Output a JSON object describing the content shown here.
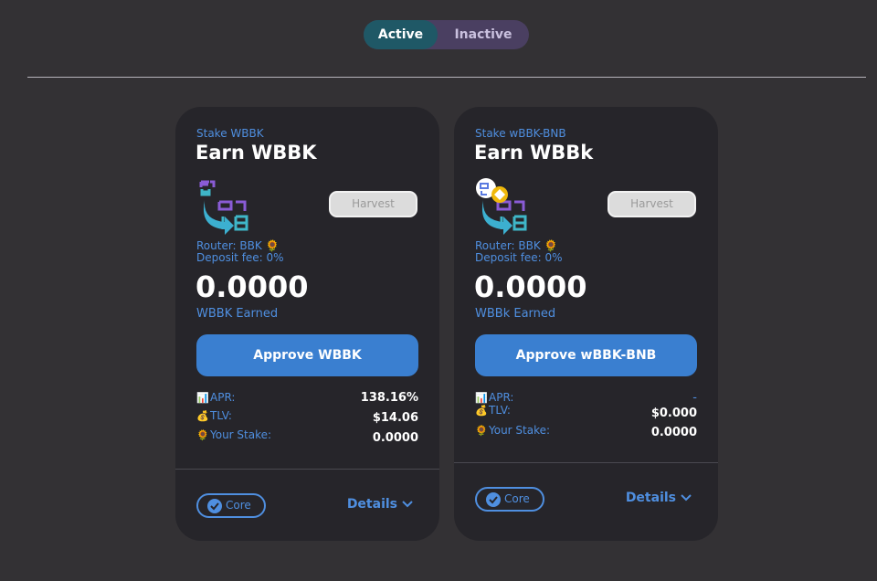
{
  "toggle": {
    "active_label": "Active",
    "inactive_label": "Inactive"
  },
  "cards": [
    {
      "stake_label": "Stake WBBK",
      "earn_title": "Earn WBBK",
      "harvest_label": "Harvest",
      "router": "Router: BBK 🌻",
      "deposit_fee": "Deposit fee: 0%",
      "amount": "0.0000",
      "earned_label": "WBBK Earned",
      "approve_label": "Approve WBBK",
      "apr_label": "APR:",
      "apr_value": "138.16%",
      "tlv_label": "TLV:",
      "tlv_value": "$14.06",
      "stake_text_label": "Your Stake:",
      "stake_value": "0.0000",
      "core_label": "Core",
      "details_label": "Details"
    },
    {
      "stake_label": "Stake wBBK-BNB",
      "earn_title": "Earn WBBk",
      "harvest_label": "Harvest",
      "router": "Router: BBK 🌻",
      "deposit_fee": "Deposit fee: 0%",
      "amount": "0.0000",
      "earned_label": "WBBk Earned",
      "approve_label": "Approve wBBK-BNB",
      "apr_label": "APR:",
      "apr_value": "-",
      "tlv_label": "TLV:",
      "tlv_value": "$0.000",
      "stake_text_label": "Your Stake:",
      "stake_value": "0.0000",
      "core_label": "Core",
      "details_label": "Details"
    }
  ],
  "colors": {
    "accent": "#3a7fd0",
    "link": "#4f8fe0",
    "card_bg": "#26252a",
    "page_bg": "#333134"
  },
  "icons": {
    "apr": "chart-icon",
    "tlv": "money-bag-icon",
    "stake": "sunflower-icon",
    "core": "verified-check-icon",
    "details": "chevron-down-icon"
  }
}
